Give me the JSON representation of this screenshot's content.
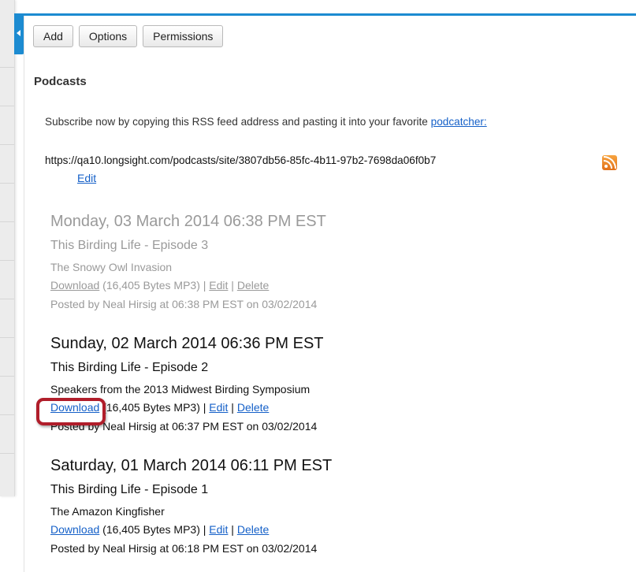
{
  "toolbar": {
    "add_label": "Add",
    "options_label": "Options",
    "permissions_label": "Permissions"
  },
  "page": {
    "title": "Podcasts",
    "subscribe_text": "Subscribe now by copying this RSS feed address and pasting it into your favorite ",
    "podcatcher_link": "podcatcher:",
    "feed_url": "https://qa10.longsight.com/podcasts/site/3807db56-85fc-4b11-97b2-7698da06f0b7",
    "feed_edit": "Edit"
  },
  "episodes": [
    {
      "date": "Monday, 03 March 2014 06:38 PM EST",
      "title": "This Birding Life - Episode 3",
      "description": "The Snowy Owl Invasion",
      "download": "Download",
      "size": " (16,405 Bytes MP3) | ",
      "edit": "Edit",
      "sep": " | ",
      "delete": "Delete",
      "posted": "Posted by Neal Hirsig at 06:38 PM EST on 03/02/2014"
    },
    {
      "date": "Sunday, 02 March 2014 06:36 PM EST",
      "title": "This Birding Life - Episode 2",
      "description": "Speakers from the 2013 Midwest Birding Symposium",
      "download": "Download",
      "size": " (16,405 Bytes MP3) | ",
      "edit": "Edit",
      "sep": " | ",
      "delete": "Delete",
      "posted": "Posted by Neal Hirsig at 06:37 PM EST on 03/02/2014"
    },
    {
      "date": "Saturday, 01 March 2014 06:11 PM EST",
      "title": "This Birding Life - Episode 1",
      "description": "The Amazon Kingfisher",
      "download": "Download",
      "size": " (16,405 Bytes MP3) | ",
      "edit": "Edit",
      "sep": " | ",
      "delete": "Delete",
      "posted": "Posted by Neal Hirsig at 06:18 PM EST on 03/02/2014"
    }
  ],
  "colors": {
    "accent": "#1c8bd1",
    "link": "#1560c8",
    "highlight": "#b01d2a",
    "rss": "#f08a24"
  }
}
